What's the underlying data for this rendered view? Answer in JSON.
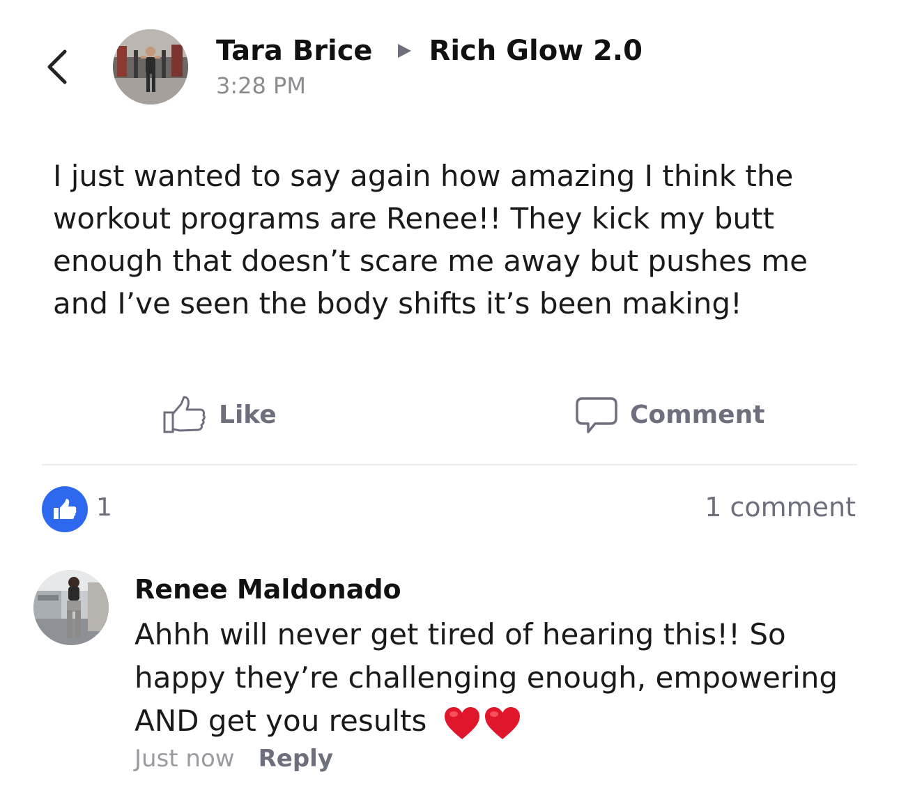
{
  "header": {
    "back_icon": "chevron-left-icon",
    "author": "Tara Brice",
    "separator_icon": "triangle-right-icon",
    "group": "Rich Glow 2.0",
    "time": "3:28 PM"
  },
  "post": {
    "body": "I just wanted to say again how amazing I think the workout programs are Renee!! They kick my butt enough that doesn’t scare me away but pushes me and I’ve seen the body shifts it’s been making!"
  },
  "actions": {
    "like_label": "Like",
    "like_icon": "thumbs-up-outline-icon",
    "comment_label": "Comment",
    "comment_icon": "speech-bubble-icon"
  },
  "stats": {
    "like_count": "1",
    "comment_count": "1 comment",
    "like_badge_color": "#2e68ef"
  },
  "comment": {
    "author": "Renee Maldonado",
    "text": "Ahhh will never get tired of hearing this!! So happy they’re challenging enough, empowering AND get you results",
    "emoji_count": 2,
    "emoji_icon": "red-heart-icon",
    "time": "Just now",
    "reply_label": "Reply"
  },
  "colors": {
    "muted": "#6d6f7d",
    "time": "#8a8a8f",
    "accent": "#2e68ef",
    "heart": "#e0162b"
  }
}
